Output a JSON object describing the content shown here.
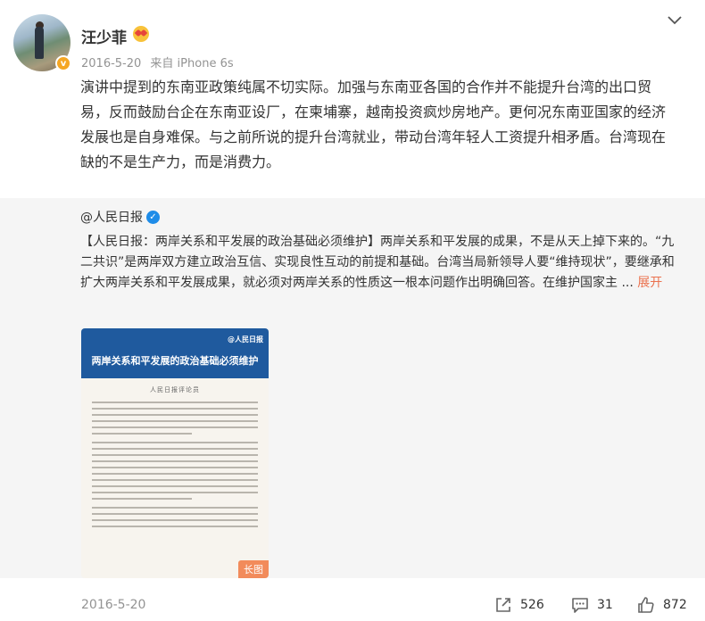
{
  "post": {
    "author": "汪少菲",
    "date": "2016-5-20",
    "source": "来自 iPhone 6s",
    "text": "演讲中提到的东南亚政策纯属不切实际。加强与东南亚各国的合作并不能提升台湾的出口贸易，反而鼓励台企在东南亚设厂，在柬埔寨，越南投资疯炒房地产。更何况东南亚国家的经济发展也是自身难保。与之前所说的提升台湾就业，带动台湾年轻人工资提升相矛盾。台湾现在缺的不是生产力，而是消费力。"
  },
  "repost": {
    "author": "@人民日报",
    "text": "【人民日报：两岸关系和平发展的政治基础必须维护】两岸关系和平发展的成果，不是从天上掉下来的。“九二共识”是两岸双方建立政治互信、实现良性互动的前提和基础。台湾当局新领导人要“维持现状”，要继承和扩大两岸关系和平发展成果，就必须对两岸关系的性质这一根本问题作出明确回答。在维护国家主 ...",
    "expand": "展开",
    "image": {
      "title": "两岸关系和平发展的政治基础必须维护",
      "subtitle": "人民日报评论员",
      "logo": "@人民日报",
      "badge": "长图"
    }
  },
  "footer": {
    "date": "2016-5-20",
    "shares": "526",
    "comments": "31",
    "likes": "872"
  },
  "colors": {
    "link": "#eb7350",
    "meta": "#939393",
    "repost_bg": "#f5f5f5",
    "vip": "#f5a623"
  },
  "icons": [
    "chevron-down-icon",
    "share-icon",
    "comment-icon",
    "like-icon",
    "verified-icon",
    "emoji-icon"
  ]
}
